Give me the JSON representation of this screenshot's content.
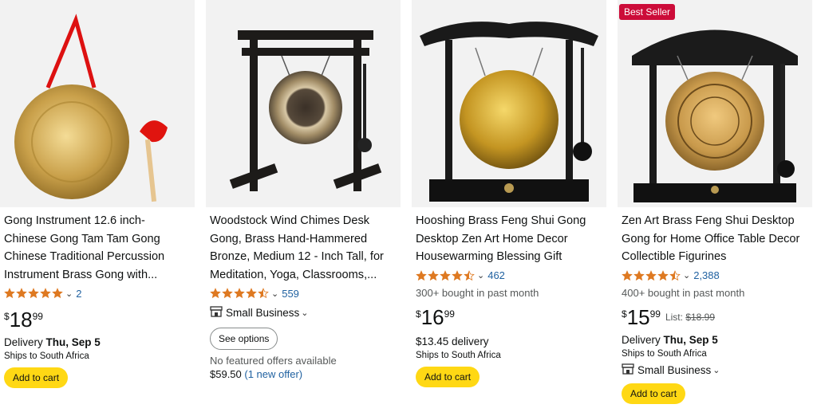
{
  "products": [
    {
      "title": "Gong Instrument 12.6 inch- Chinese Gong Tam Tam Gong Chinese Traditional Percussion Instrument Brass Gong with...",
      "rating": 5.0,
      "rating_count": "2",
      "price_symbol": "$",
      "price_whole": "18",
      "price_fraction": "99",
      "delivery_label": "Delivery",
      "delivery_date": "Thu, Sep 5",
      "ships": "Ships to South Africa",
      "cart_label": "Add to cart"
    },
    {
      "title": "Woodstock Wind Chimes Desk Gong, Brass Hand-Hammered Bronze, Medium 12 - Inch Tall, for Meditation, Yoga, Classrooms,...",
      "rating": 4.5,
      "rating_count": "559",
      "small_business": "Small Business",
      "options_label": "See options",
      "no_offers": "No featured offers available",
      "offer_price": "$59.50",
      "offer_link": "(1 new offer)"
    },
    {
      "title": "Hooshing Brass Feng Shui Gong Desktop Zen Art Home Decor Housewarming Blessing Gift",
      "rating": 4.5,
      "rating_count": "462",
      "bought": "300+ bought in past month",
      "price_symbol": "$",
      "price_whole": "16",
      "price_fraction": "99",
      "delivery_fee": "$13.45 delivery",
      "ships": "Ships to South Africa",
      "cart_label": "Add to cart"
    },
    {
      "badge": "Best Seller",
      "title": "Zen Art Brass Feng Shui Desktop Gong for Home Office Table Decor Collectible Figurines",
      "rating": 4.5,
      "rating_count": "2,388",
      "bought": "400+ bought in past month",
      "price_symbol": "$",
      "price_whole": "15",
      "price_fraction": "99",
      "list_label": "List:",
      "list_price": "$18.99",
      "delivery_label": "Delivery",
      "delivery_date": "Thu, Sep 5",
      "ships": "Ships to South Africa",
      "small_business": "Small Business",
      "cart_label": "Add to cart"
    }
  ],
  "colors": {
    "star": "#de7921",
    "link": "#2162a1",
    "cart": "#ffd814",
    "badge": "#cc0c39"
  }
}
